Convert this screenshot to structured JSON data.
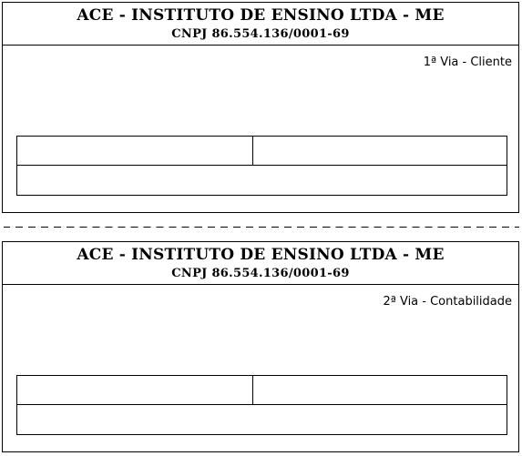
{
  "company": {
    "name": "ACE - INSTITUTO DE ENSINO LTDA - ME",
    "cnpj": "CNPJ 86.554.136/0001-69"
  },
  "copies": [
    {
      "via_label": "1ª Via - Cliente"
    },
    {
      "via_label": "2ª Via - Contabilidade"
    }
  ]
}
